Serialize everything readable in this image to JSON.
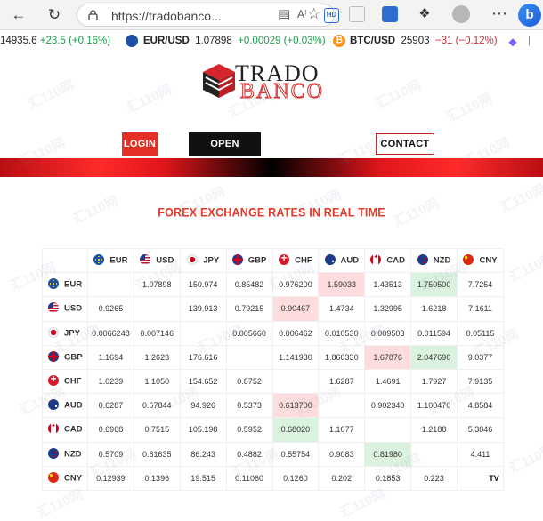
{
  "browser": {
    "url": "https://tradobanco...",
    "read_aloud": "A⁾",
    "hd_label": "HD"
  },
  "ticker": [
    {
      "symbol": "",
      "price": "14935.6",
      "change": "+23.5 (+0.16%)",
      "dir": "pos"
    },
    {
      "symbol": "EUR/USD",
      "price": "1.07898",
      "change": "+0.00029 (+0.03%)",
      "dir": "pos"
    },
    {
      "symbol": "BTC/USD",
      "price": "25903",
      "change": "−31 (−0.12%)",
      "dir": "neg"
    }
  ],
  "logo": {
    "line1": "TRADO",
    "line2": "BANCO"
  },
  "nav": {
    "login": "LOGIN",
    "open_account": "OPEN ACCOUNT",
    "contact_us": "CONTACT US"
  },
  "section": {
    "title": "FOREX EXCHANGE RATES IN REAL TIME"
  },
  "rates": {
    "currencies": [
      "EUR",
      "USD",
      "JPY",
      "GBP",
      "CHF",
      "AUD",
      "CAD",
      "NZD",
      "CNY"
    ],
    "rows": [
      [
        "",
        "1.07898",
        "150.974",
        "0.85482",
        "0.976200",
        "1.59033",
        "1.43513",
        "1.750500",
        "7.7254"
      ],
      [
        "0.9265",
        "",
        "139.913",
        "0.79215",
        "0.90467",
        "1.4734",
        "1.32995",
        "1.6218",
        "7.1611"
      ],
      [
        "0.0066248",
        "0.007146",
        "",
        "0.005660",
        "0.006462",
        "0.010530",
        "0.009503",
        "0.011594",
        "0.05115"
      ],
      [
        "1.1694",
        "1.2623",
        "176.616",
        "",
        "1.141930",
        "1.860330",
        "1.67876",
        "2.047690",
        "9.0377"
      ],
      [
        "1.0239",
        "1.1050",
        "154.652",
        "0.8752",
        "",
        "1.6287",
        "1.4691",
        "1.7927",
        "7.9135"
      ],
      [
        "0.6287",
        "0.67844",
        "94.926",
        "0.5373",
        "0.613700",
        "",
        "0.902340",
        "1.100470",
        "4.8584"
      ],
      [
        "0.6968",
        "0.7515",
        "105.198",
        "0.5952",
        "0.68020",
        "1.1077",
        "",
        "1.2188",
        "5.3846"
      ],
      [
        "0.5709",
        "0.61635",
        "86.243",
        "0.4882",
        "0.55754",
        "0.9083",
        "0.81980",
        "",
        "4.411"
      ],
      [
        "0.12939",
        "0.1396",
        "19.515",
        "0.11060",
        "0.1260",
        "0.202",
        "0.1853",
        "0.223",
        ""
      ]
    ],
    "highlights": {
      "0-5": "red",
      "0-7": "green",
      "1-4": "red",
      "3-6": "red",
      "3-7": "green",
      "5-4": "red",
      "6-4": "green",
      "7-6": "green"
    },
    "colors": {
      "red": "#fcdcdc",
      "green": "#daf2de"
    }
  },
  "widget_badge": "TV",
  "watermark": "汇110网"
}
